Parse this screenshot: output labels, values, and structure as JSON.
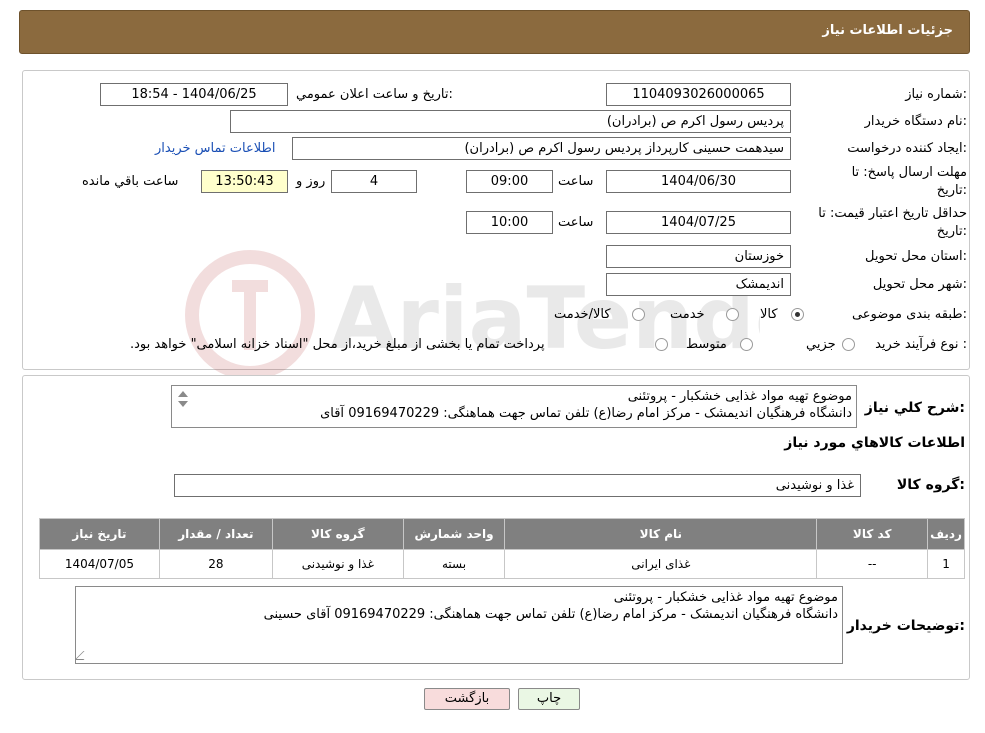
{
  "header": {
    "title": "جزئیات اطلاعات نیاز"
  },
  "labels": {
    "need_number": "شماره نیاز:",
    "announce_datetime": "تاریخ و ساعت اعلان عمومي:",
    "buyer_org": "نام دستگاه خريدار:",
    "creator": "ايجاد كننده درخواست:",
    "buyer_contact_link": "اطلاعات تماس خريدار",
    "reply_deadline_line1": "مهلت ارسال پاسخ: تا",
    "reply_deadline_line2": "تاريخ:",
    "time": "ساعت",
    "days_and": "روز و",
    "remaining": "ساعت باقي مانده",
    "price_validity_line1": "حداقل تاريخ اعتبار قيمت: تا",
    "price_validity_line2": "تاريخ:",
    "province": "استان محل تحويل:",
    "city": "شهر محل تحويل:",
    "category": "طبقه بندی موضوعی:",
    "process_type": "نوع فرآيند خريد :",
    "overall_desc": "شرح كلي نياز:",
    "goods_info": "اطلاعات كالاهاي مورد نياز",
    "goods_group": "گروه کالا:",
    "buyer_notes": "توضيحات خريدار:"
  },
  "values": {
    "need_number": "1104093026000065",
    "announce_datetime": "1404/06/25 - 18:54",
    "buyer_org": "پردیس رسول اکرم ص (برادران)",
    "creator": "سیدهمت حسینی کارپرداز پردیس رسول اکرم ص (برادران)",
    "reply_date": "1404/06/30",
    "reply_time": "09:00",
    "days": "4",
    "remaining_time": "13:50:43",
    "price_date": "1404/07/25",
    "price_time": "10:00",
    "province": "خوزستان",
    "city": "اندیمشک",
    "goods_group": "غذا و نوشیدنی"
  },
  "category_options": [
    {
      "label": "كالا",
      "checked": true
    },
    {
      "label": "خدمت",
      "checked": false
    },
    {
      "label": "كالا/خدمت",
      "checked": false
    }
  ],
  "process_options": [
    {
      "label": "جزيي",
      "checked": false
    },
    {
      "label": "متوسط",
      "checked": false
    }
  ],
  "process_note": "پرداخت تمام يا بخشی از مبلغ خريد،از محل \"اسناد خزانه اسلامی\" خواهد بود.",
  "overall_desc_lines": [
    "موضوع تهیه مواد غذایی خشکبار -  پروتئنی",
    "دانشگاه فرهنگیان  اندیمشک - مرکز امام رضا(ع) تلفن تماس جهت هماهنگی:  09169470229  آقای"
  ],
  "table": {
    "headers": [
      "رديف",
      "كد كالا",
      "نام كالا",
      "واحد شمارش",
      "گروه كالا",
      "تعداد / مقدار",
      "تاريخ نياز"
    ],
    "rows": [
      [
        "1",
        "--",
        "غذای ایرانی",
        "بسته",
        "غذا و نوشیدنی",
        "28",
        "1404/07/05"
      ]
    ]
  },
  "buyer_notes_lines": [
    "موضوع تهیه مواد غذایی خشکبار -  پروتئنی",
    "دانشگاه فرهنگیان  اندیمشک - مرکز امام رضا(ع) تلفن تماس جهت هماهنگی:  09169470229  آقای حسینی"
  ],
  "buttons": {
    "print": "چاپ",
    "back": "بازگشت"
  },
  "colors": {
    "header_bg": "#8b6a3e",
    "table_header_bg": "#808080",
    "remaining_bg": "#ffffcc",
    "back_btn_bg": "#f8dcdc",
    "print_btn_bg": "#eaf7e4"
  }
}
